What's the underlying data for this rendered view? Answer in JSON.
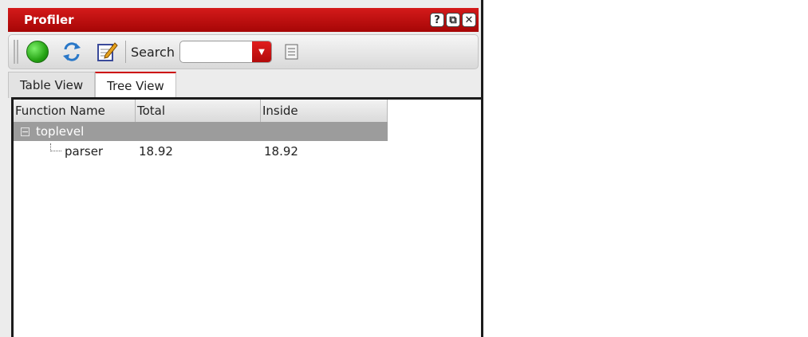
{
  "window": {
    "title": "Profiler",
    "buttons": [
      "help-icon",
      "restore-icon",
      "close-icon"
    ],
    "help_glyph": "?",
    "restore_glyph": "⧉",
    "close_glyph": "✕"
  },
  "toolbar": {
    "search_label": "Search",
    "search_value": "",
    "icons": [
      "run-icon",
      "refresh-icon",
      "edit-icon",
      "document-icon"
    ]
  },
  "tabs": [
    {
      "label": "Table View",
      "active": false
    },
    {
      "label": "Tree View",
      "active": true
    }
  ],
  "tree": {
    "columns": [
      "Function Name",
      "Total",
      "Inside"
    ],
    "expander_glyph": "−",
    "rows": [
      {
        "name": "toplevel",
        "total": "",
        "inside": "",
        "level": 0,
        "selected": true
      },
      {
        "name": "parser",
        "total": "18.92",
        "inside": "18.92",
        "level": 1,
        "selected": false
      }
    ]
  },
  "colors": {
    "accent": "#c00000",
    "selected_row": "#9c9c9c",
    "run_button": "#27a515"
  }
}
